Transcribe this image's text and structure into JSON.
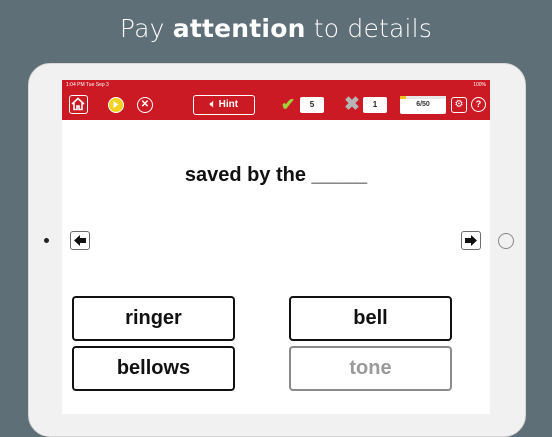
{
  "headline": {
    "pre": "Pay ",
    "bold": "attention",
    "post": " to details"
  },
  "status_bar": {
    "time": "1:04 PM  Tue Sep 3",
    "battery": "100%"
  },
  "toolbar": {
    "hint_label": "Hint",
    "correct_count": "5",
    "wrong_count": "1",
    "progress_text": "6/50",
    "progress_fraction": 0.12
  },
  "question": "saved by the _____",
  "answers": [
    {
      "label": "ringer",
      "state": "active"
    },
    {
      "label": "bell",
      "state": "active"
    },
    {
      "label": "bellows",
      "state": "active"
    },
    {
      "label": "tone",
      "state": "disabled"
    }
  ],
  "colors": {
    "toolbar_red": "#cc1a24",
    "progress_fill": "#f2c21b",
    "check_green": "#9fd23b",
    "background": "#5f6f78"
  },
  "icons": [
    "home-icon",
    "play-icon",
    "close-icon",
    "speaker-icon",
    "check-icon",
    "cross-icon",
    "gear-icon",
    "help-icon",
    "arrow-left-icon",
    "arrow-right-icon"
  ]
}
